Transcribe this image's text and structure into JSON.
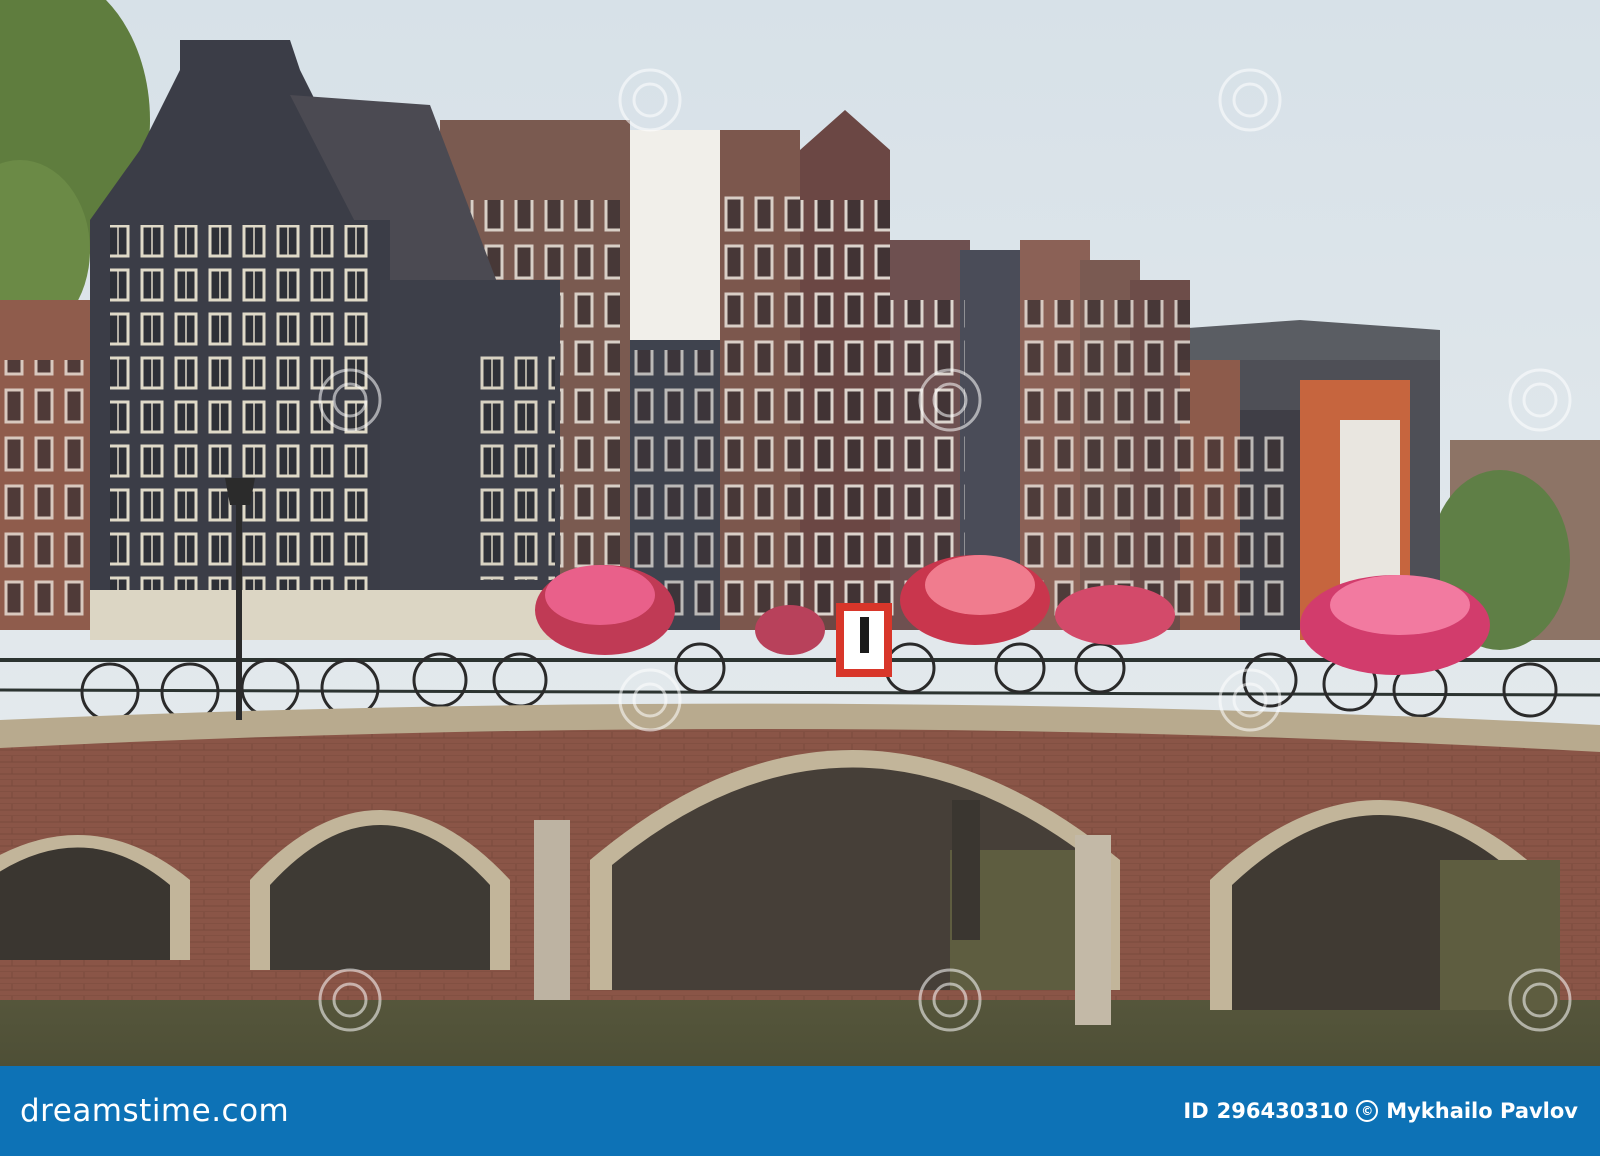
{
  "scene": "Amsterdam canal houses behind a brick arched bridge with bicycles and hanging flower baskets",
  "watermark": {
    "brand": "dreamstime.com",
    "small": "dreamstime"
  },
  "footer": {
    "id_prefix": "ID",
    "id_value": "296430310",
    "author": "Mykhailo Pavlov"
  },
  "colors": {
    "footer_bg": "#0d72b6",
    "sky": "#dfe7ec",
    "brick": "#8a5547",
    "water": "#5b5a3c",
    "dark_house": "#3e3f48"
  }
}
